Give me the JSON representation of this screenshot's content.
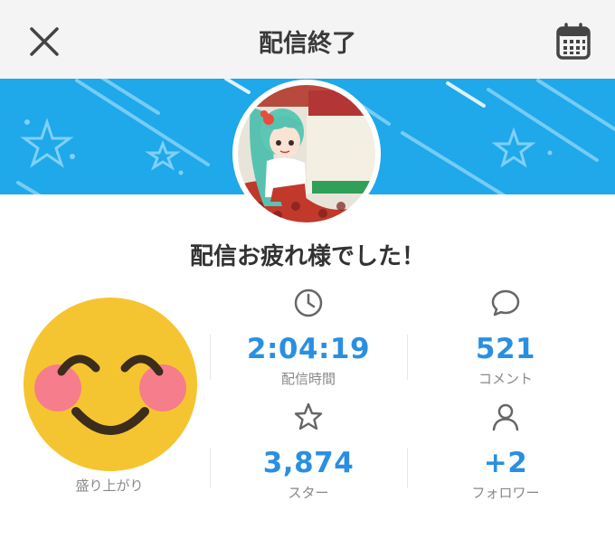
{
  "header": {
    "title": "配信終了",
    "close_icon": "close-icon",
    "calendar_icon": "calendar-icon"
  },
  "banner": {
    "color": "#1fa8ea"
  },
  "heading": "配信お疲れ様でした！",
  "stats": {
    "excitement": {
      "label": "盛り上がり",
      "icon": "smiling-face-emoji"
    },
    "duration": {
      "value": "2:04:19",
      "label": "配信時間",
      "icon": "clock-icon"
    },
    "comments": {
      "value": "521",
      "label": "コメント",
      "icon": "speech-bubble-icon"
    },
    "stars": {
      "value": "3,874",
      "label": "スター",
      "icon": "star-icon"
    },
    "followers": {
      "value": "+2",
      "label": "フォロワー",
      "icon": "person-icon"
    }
  },
  "colors": {
    "accent": "#2a8fe0",
    "banner": "#1fa8ea",
    "label": "#888888"
  }
}
